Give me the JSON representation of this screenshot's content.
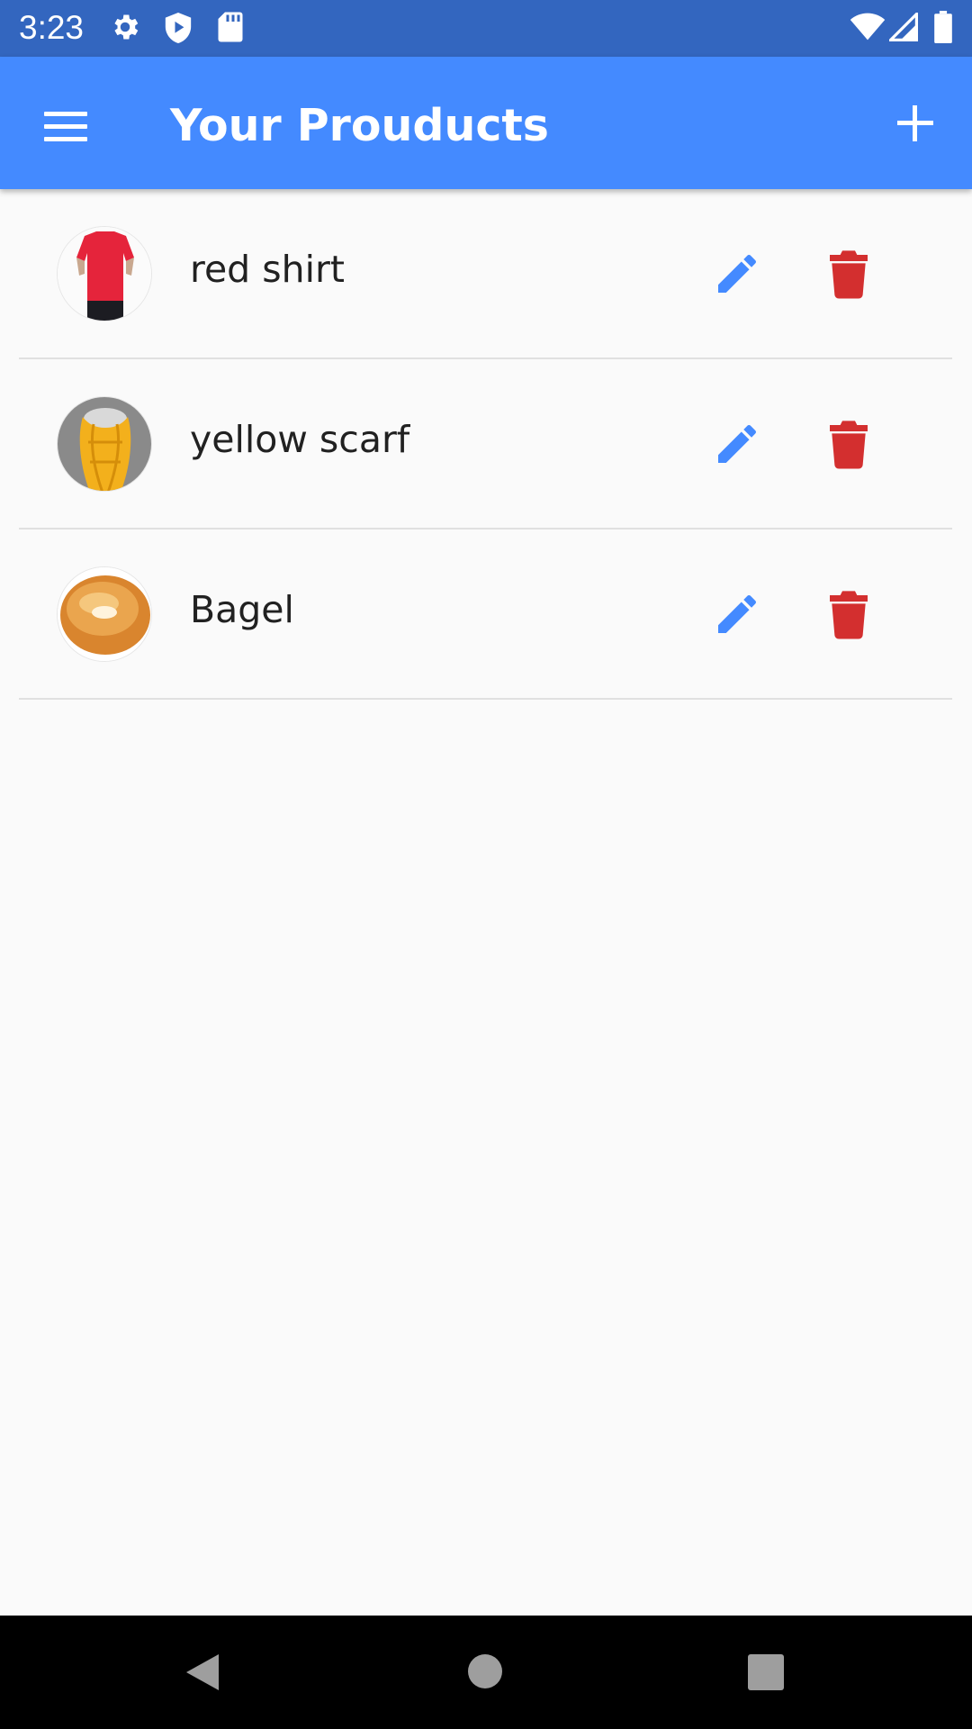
{
  "status_bar": {
    "time": "3:23",
    "icons": [
      "settings-icon",
      "shield-icon",
      "sd-card-icon",
      "wifi-icon",
      "signal-icon",
      "battery-icon"
    ]
  },
  "app_bar": {
    "title": "Your Prouducts",
    "menu_icon": "menu-icon",
    "add_icon": "add-icon",
    "background": "#448aff"
  },
  "products": [
    {
      "title": "red shirt",
      "image": "red-shirt-photo"
    },
    {
      "title": "yellow scarf",
      "image": "yellow-scarf-photo"
    },
    {
      "title": "Bagel",
      "image": "bagel-photo"
    }
  ],
  "actions": {
    "edit_icon": "edit-pencil-icon",
    "edit_color": "#448aff",
    "delete_icon": "trash-icon",
    "delete_color": "#d32f2f"
  },
  "nav_bar": {
    "icons": [
      "back-icon",
      "home-icon",
      "recents-icon"
    ]
  }
}
